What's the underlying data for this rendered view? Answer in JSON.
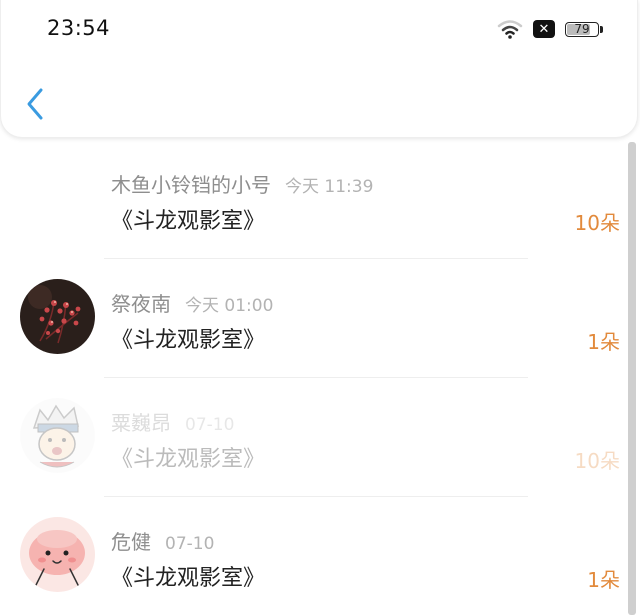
{
  "status_bar": {
    "time": "23:54",
    "battery": "79",
    "battery_level": 0.79
  },
  "list": [
    {
      "name": "木鱼小铃铛的小号",
      "time": "今天 11:39",
      "title": "《斗龙观影室》",
      "count": "10朵",
      "has_avatar": false,
      "faded": false
    },
    {
      "name": "祭夜南",
      "time": "今天 01:00",
      "title": "《斗龙观影室》",
      "count": "1朵",
      "has_avatar": true,
      "faded": false
    },
    {
      "name": "粟巍昂",
      "time": "07-10",
      "title": "《斗龙观影室》",
      "count": "10朵",
      "has_avatar": true,
      "faded": true
    },
    {
      "name": "危健",
      "time": "07-10",
      "title": "《斗龙观影室》",
      "count": "1朵",
      "has_avatar": true,
      "faded": false
    }
  ],
  "colors": {
    "accent": "#3a9be0",
    "count": "#e28a3c",
    "name": "#8e8e8e",
    "title": "#222222"
  },
  "icons": {
    "back": "chevron-left-icon",
    "wifi": "wifi-icon",
    "sim": "no-sim-icon",
    "battery": "battery-icon"
  }
}
